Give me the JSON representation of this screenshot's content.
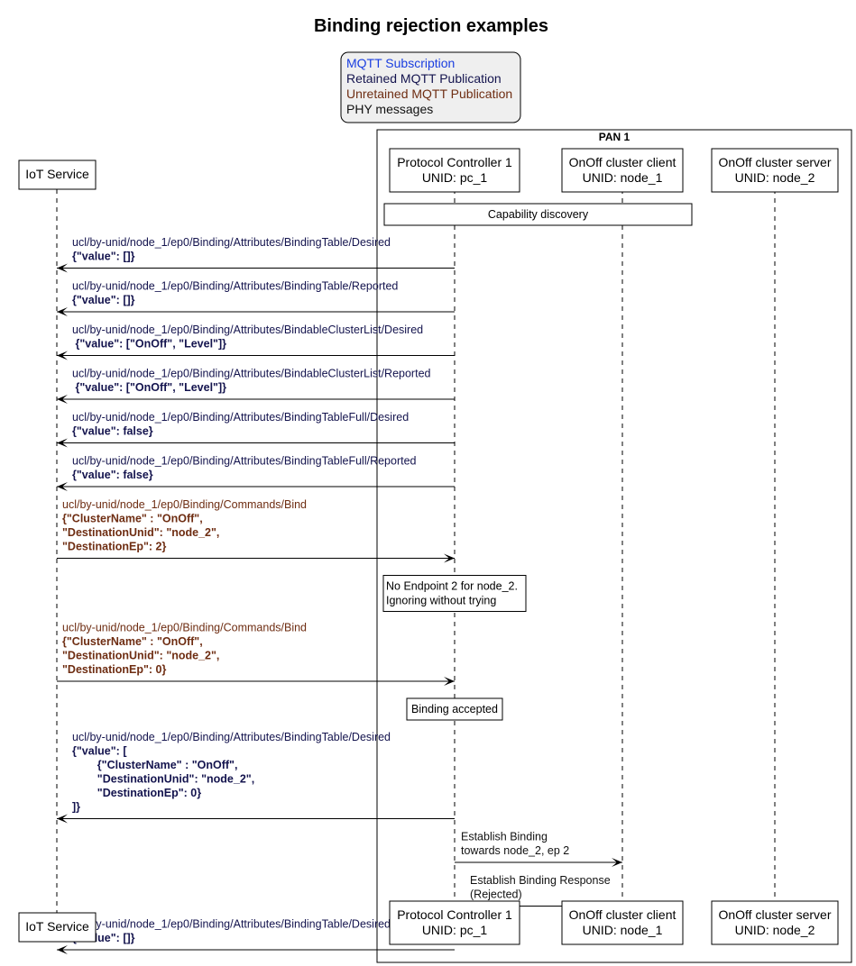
{
  "title": "Binding rejection examples",
  "colors": {
    "subscription": "#1a3ee0",
    "retained": "#14144e",
    "unretained": "#6e2d12",
    "phy": "#111111",
    "legend_bg": "#efefef"
  },
  "legend": [
    {
      "label": "MQTT Subscription",
      "kind": "subscription"
    },
    {
      "label": "Retained MQTT Publication",
      "kind": "retained"
    },
    {
      "label": "Unretained MQTT Publication",
      "kind": "unretained"
    },
    {
      "label": "PHY messages",
      "kind": "phy"
    }
  ],
  "group": {
    "label": "PAN 1"
  },
  "participants": [
    {
      "id": "iot",
      "lines": [
        "IoT Service"
      ]
    },
    {
      "id": "pc",
      "lines": [
        "Protocol Controller 1",
        "UNID: pc_1"
      ]
    },
    {
      "id": "client",
      "lines": [
        "OnOff cluster client",
        "UNID: node_1"
      ]
    },
    {
      "id": "server",
      "lines": [
        "OnOff cluster server",
        "UNID: node_2"
      ]
    }
  ],
  "events": [
    {
      "type": "note",
      "over": [
        "pc",
        "client"
      ],
      "lines": [
        "Capability discovery"
      ],
      "wide": true
    },
    {
      "type": "msg",
      "from": "pc",
      "to": "iot",
      "kind": "retained",
      "topic": "ucl/by-unid/node_1/ep0/Binding/Attributes/BindingTable/Desired",
      "payload": [
        "{\"value\": []}"
      ]
    },
    {
      "type": "msg",
      "from": "pc",
      "to": "iot",
      "kind": "retained",
      "topic": "ucl/by-unid/node_1/ep0/Binding/Attributes/BindingTable/Reported",
      "payload": [
        "{\"value\": []}"
      ]
    },
    {
      "type": "msg",
      "from": "pc",
      "to": "iot",
      "kind": "retained",
      "topic": "ucl/by-unid/node_1/ep0/Binding/Attributes/BindableClusterList/Desired",
      "payload": [
        " {\"value\": [\"OnOff\", \"Level\"]}"
      ]
    },
    {
      "type": "msg",
      "from": "pc",
      "to": "iot",
      "kind": "retained",
      "topic": "ucl/by-unid/node_1/ep0/Binding/Attributes/BindableClusterList/Reported",
      "payload": [
        " {\"value\": [\"OnOff\", \"Level\"]}"
      ]
    },
    {
      "type": "msg",
      "from": "pc",
      "to": "iot",
      "kind": "retained",
      "topic": "ucl/by-unid/node_1/ep0/Binding/Attributes/BindingTableFull/Desired",
      "payload": [
        "{\"value\": false}"
      ]
    },
    {
      "type": "msg",
      "from": "pc",
      "to": "iot",
      "kind": "retained",
      "topic": "ucl/by-unid/node_1/ep0/Binding/Attributes/BindingTableFull/Reported",
      "payload": [
        "{\"value\": false}"
      ]
    },
    {
      "type": "msg",
      "from": "iot",
      "to": "pc",
      "kind": "unretained",
      "topic": "ucl/by-unid/node_1/ep0/Binding/Commands/Bind",
      "payload": [
        "{\"ClusterName\" : \"OnOff\",",
        "\"DestinationUnid\": \"node_2\",",
        "\"DestinationEp\": 2}"
      ]
    },
    {
      "type": "note",
      "over": [
        "pc"
      ],
      "lines": [
        "No Endpoint 2 for node_2.",
        "Ignoring without trying"
      ]
    },
    {
      "type": "msg",
      "from": "iot",
      "to": "pc",
      "kind": "unretained",
      "topic": "ucl/by-unid/node_1/ep0/Binding/Commands/Bind",
      "payload": [
        "{\"ClusterName\" : \"OnOff\",",
        "\"DestinationUnid\": \"node_2\",",
        "\"DestinationEp\": 0}"
      ]
    },
    {
      "type": "note",
      "over": [
        "pc"
      ],
      "lines": [
        "Binding accepted"
      ],
      "center": true
    },
    {
      "type": "msg",
      "from": "pc",
      "to": "iot",
      "kind": "retained",
      "topic": "ucl/by-unid/node_1/ep0/Binding/Attributes/BindingTable/Desired",
      "payload": [
        "{\"value\": [",
        "        {\"ClusterName\" : \"OnOff\",",
        "        \"DestinationUnid\": \"node_2\",",
        "        \"DestinationEp\": 0}",
        "]}"
      ]
    },
    {
      "type": "msg",
      "from": "pc",
      "to": "client",
      "kind": "phy",
      "topic": "Establish Binding",
      "topic2": "towards node_2, ep 2",
      "payload": []
    },
    {
      "type": "msg",
      "from": "client",
      "to": "pc",
      "kind": "phy",
      "topic": "Establish Binding Response",
      "topic2": "(Rejected)",
      "payload": []
    },
    {
      "type": "msg",
      "from": "pc",
      "to": "iot",
      "kind": "retained",
      "topic": "ucl/by-unid/node_1/ep0/Binding/Attributes/BindingTable/Desired",
      "payload": [
        "{\"value\": []}"
      ]
    }
  ]
}
